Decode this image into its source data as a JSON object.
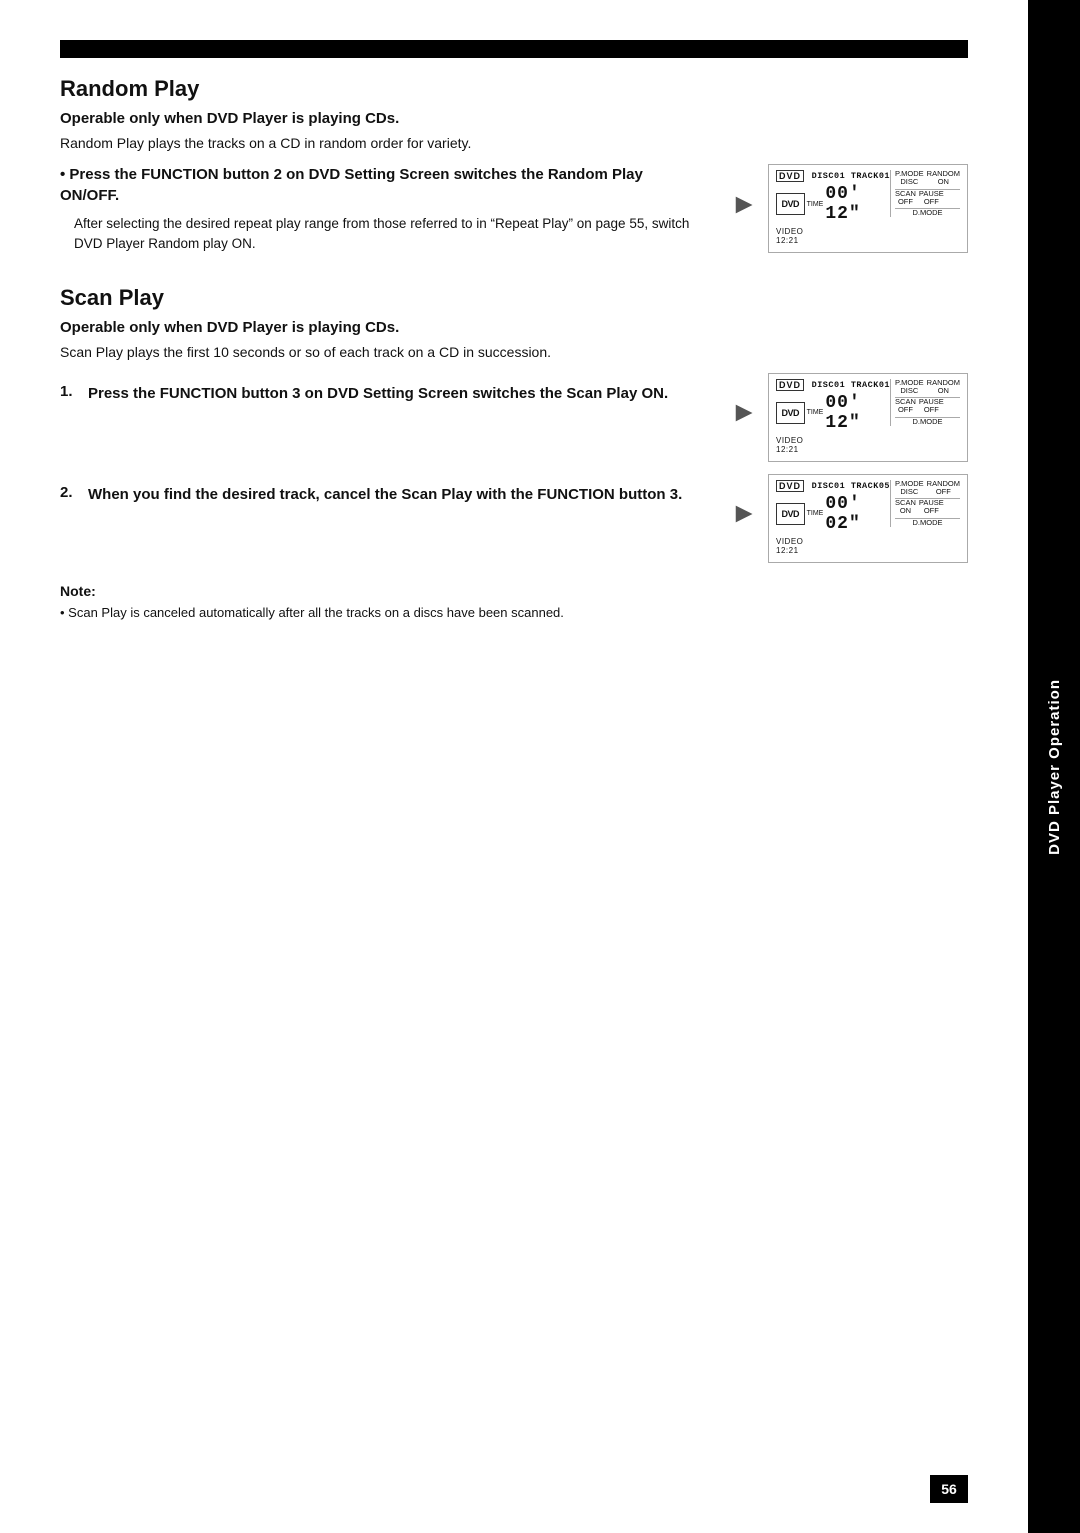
{
  "page": {
    "top_bar_visible": true,
    "side_tab_text": "DVD Player Operation",
    "page_number": "56"
  },
  "random_play": {
    "title": "Random Play",
    "sub_heading": "Operable only when DVD Player is playing CDs.",
    "intro_text": "Random Play plays the tracks on a CD in random order for variety.",
    "bullet_heading": "Press the FUNCTION button 2 on DVD Setting Screen switches the Random Play ON/OFF.",
    "bullet_detail_1": "After selecting the desired repeat play range from those referred to in “Repeat Play” on page 55, switch DVD Player Random play ON.",
    "display1": {
      "dvd": "DVD",
      "track_info": "DISC01 TRACK01",
      "time_label": "TIME",
      "time_value": "00' 12\"",
      "video_label": "VIDEO\n12:21",
      "pmode": "P.MODE\nDISC",
      "random": "RANDOM\nON",
      "scan": "SCAN\nOFF",
      "pause": "PAUSE\nOFF",
      "dmode": "D.MODE"
    }
  },
  "scan_play": {
    "title": "Scan Play",
    "sub_heading": "Operable only when DVD Player is playing CDs.",
    "intro_text": "Scan Play plays the first 10 seconds or so of each track on a CD in succession.",
    "step1": {
      "number": "1.",
      "text": "Press the FUNCTION button 3 on DVD Setting Screen switches the Scan Play ON.",
      "display": {
        "dvd": "DVD",
        "track_info": "DISC01 TRACK01",
        "time_label": "TIME",
        "time_value": "00' 12\"",
        "video_label": "VIDEO\n12:21",
        "pmode": "P.MODE\nDISC",
        "random": "RANDOM\nON",
        "scan": "SCAN\nOFF",
        "pause": "PAUSE\nOFF",
        "dmode": "D.MODE"
      }
    },
    "step2": {
      "number": "2.",
      "text": "When you find the desired track, cancel the Scan Play with the FUNCTION button 3.",
      "display": {
        "dvd": "DVD",
        "track_info": "DISC01 TRACK05",
        "time_label": "TIME",
        "time_value": "00' 02\"",
        "video_label": "VIDEO\n12:21",
        "pmode": "P.MODE\nDISC",
        "random": "RANDOM\nOFF",
        "scan": "SCAN\nON",
        "pause": "PAUSE\nOFF",
        "dmode": "D.MODE"
      }
    }
  },
  "note": {
    "title": "Note:",
    "text": "Scan Play is canceled automatically after all the tracks on a discs have been scanned."
  }
}
